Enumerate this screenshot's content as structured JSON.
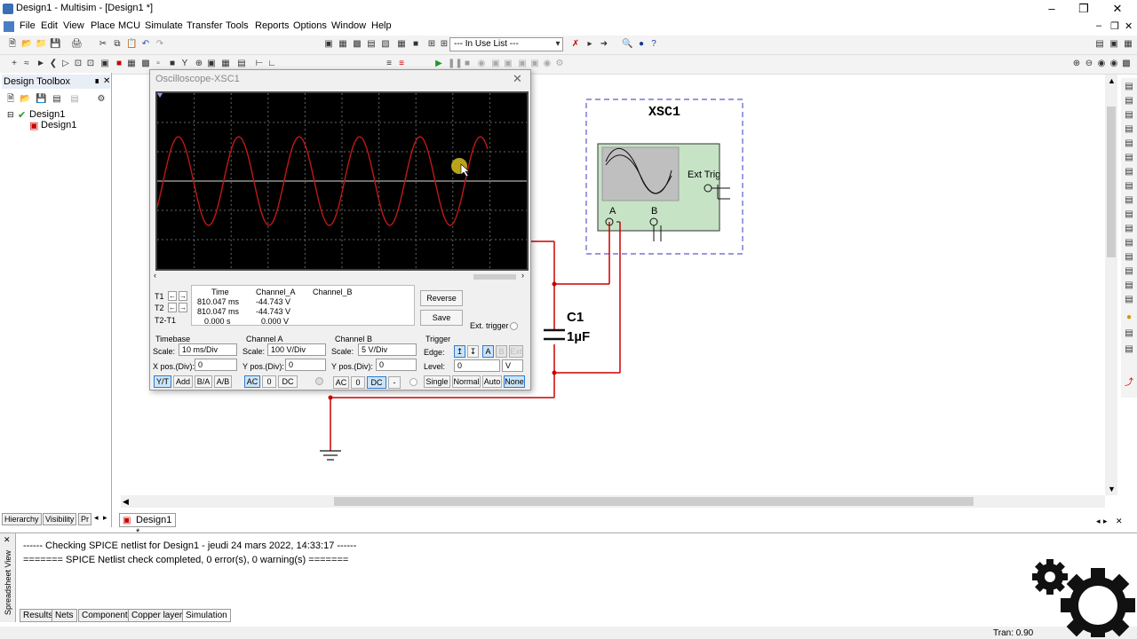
{
  "window": {
    "title": "Design1 - Multisim - [Design1 *]"
  },
  "menu": [
    "File",
    "Edit",
    "View",
    "Place",
    "MCU",
    "Simulate",
    "Transfer",
    "Tools",
    "Reports",
    "Options",
    "Window",
    "Help"
  ],
  "toolbar": {
    "in_use_list": "--- In Use List ---"
  },
  "toolbox": {
    "title": "Design Toolbox",
    "tree_root": "Design1",
    "tree_child": "Design1",
    "tabs": [
      "Hierarchy",
      "Visibility",
      "Pr"
    ]
  },
  "oscilloscope": {
    "title": "Oscilloscope-XSC1",
    "table_headers": [
      "Time",
      "Channel_A",
      "Channel_B"
    ],
    "rows": [
      {
        "label": "T1",
        "time": "810.047 ms",
        "a": "-44.743 V",
        "b": ""
      },
      {
        "label": "T2",
        "time": "810.047 ms",
        "a": "-44.743 V",
        "b": ""
      },
      {
        "label": "T2-T1",
        "time": "0.000 s",
        "a": "0.000 V",
        "b": ""
      }
    ],
    "reverse_label": "Reverse",
    "save_label": "Save",
    "ext_trigger_label": "Ext. trigger",
    "timebase": {
      "title": "Timebase",
      "scale_label": "Scale:",
      "scale": "10 ms/Div",
      "pos_label": "X pos.(Div):",
      "pos": "0",
      "modes": [
        "Y/T",
        "Add",
        "B/A",
        "A/B"
      ]
    },
    "channel_a": {
      "title": "Channel A",
      "scale_label": "Scale:",
      "scale": "100  V/Div",
      "pos_label": "Y pos.(Div):",
      "pos": "0",
      "coupling": [
        "AC",
        "0",
        "DC"
      ]
    },
    "channel_b": {
      "title": "Channel B",
      "scale_label": "Scale:",
      "scale": "5  V/Div",
      "pos_label": "Y pos.(Div):",
      "pos": "0",
      "coupling": [
        "AC",
        "0",
        "DC",
        "-"
      ]
    },
    "trigger": {
      "title": "Trigger",
      "edge_label": "Edge:",
      "sources": [
        "A",
        "B",
        "Ext"
      ],
      "level_label": "Level:",
      "level": "0",
      "level_unit": "V",
      "modes": [
        "Single",
        "Normal",
        "Auto",
        "None"
      ]
    }
  },
  "schematic": {
    "instrument_label": "XSC1",
    "ext_trig_label": "Ext Trig",
    "port_a": "A",
    "port_b": "B",
    "cap_name": "C1",
    "cap_value": "1µF"
  },
  "design_tab": "Design1 *",
  "output": {
    "side_label": "Spreadsheet View",
    "lines": [
      "------ Checking SPICE netlist for Design1 - jeudi 24 mars 2022, 14:33:17 ------",
      "======= SPICE Netlist check completed, 0 error(s), 0 warning(s) ======="
    ],
    "tabs": [
      "Results",
      "Nets",
      "Components",
      "Copper layers",
      "Simulation"
    ]
  },
  "status": {
    "tran": "Tran: 0.90"
  }
}
